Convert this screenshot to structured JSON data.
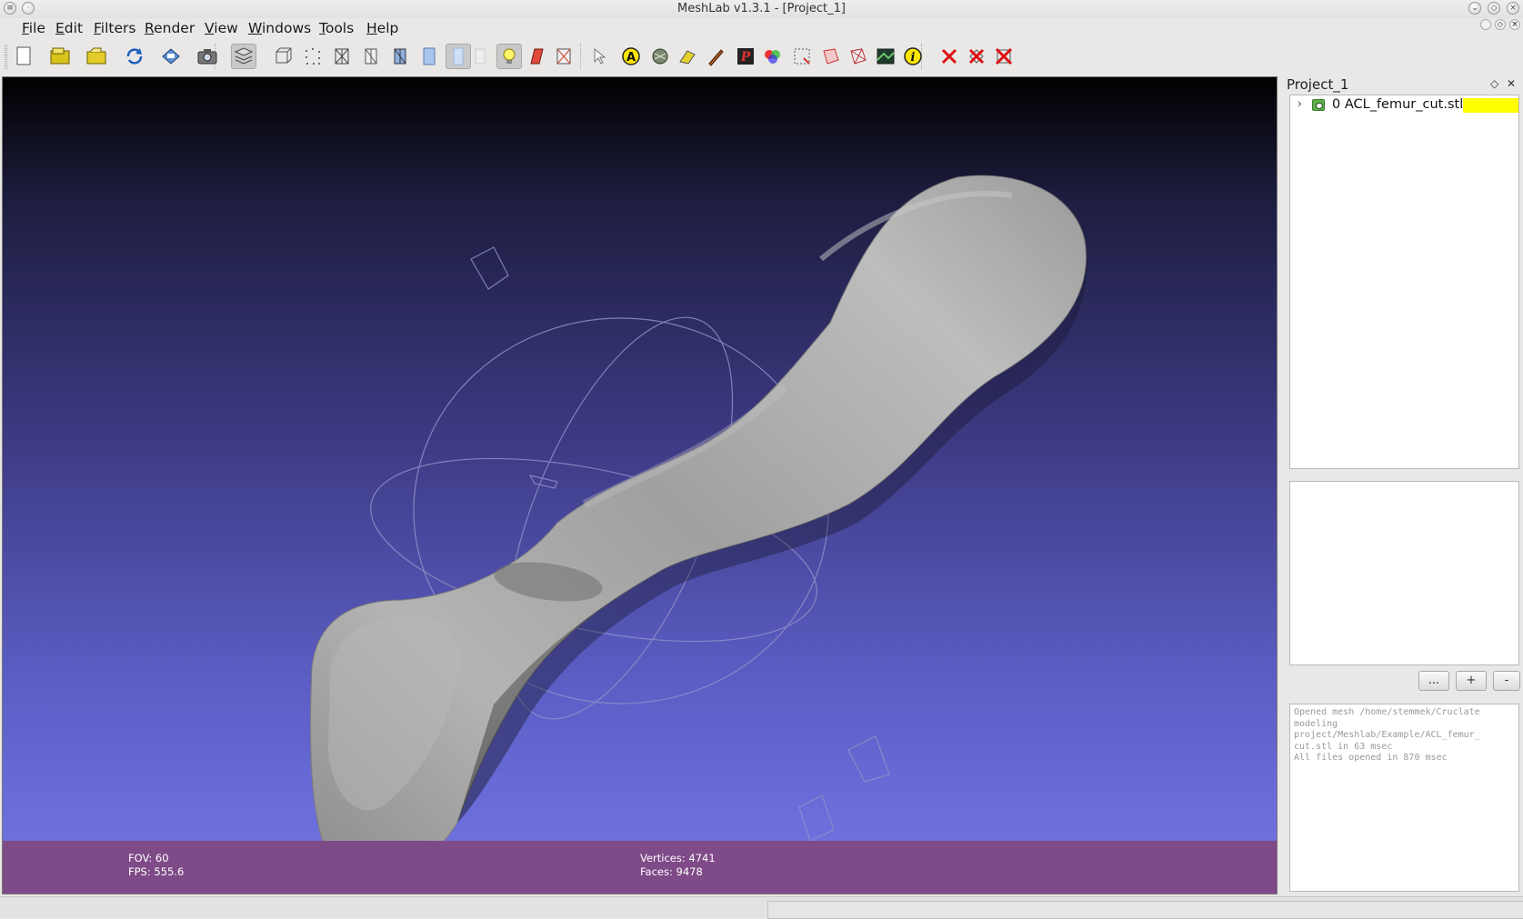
{
  "window": {
    "title": "MeshLab v1.3.1 - [Project_1]"
  },
  "menu": [
    {
      "label": "File",
      "accel": "F",
      "rest": "ile"
    },
    {
      "label": "Edit",
      "accel": "E",
      "rest": "dit"
    },
    {
      "label": "Filters",
      "accel": "F",
      "rest": "ilters"
    },
    {
      "label": "Render",
      "accel": "R",
      "rest": "ender"
    },
    {
      "label": "View",
      "accel": "V",
      "rest": "iew"
    },
    {
      "label": "Windows",
      "accel": "W",
      "rest": "indows"
    },
    {
      "label": "Tools",
      "accel": "T",
      "rest": "ools"
    },
    {
      "label": "Help",
      "accel": "H",
      "rest": "elp"
    }
  ],
  "toolbar": {
    "icons": [
      "new-project-icon",
      "open-project-icon",
      "import-mesh-icon",
      "reload-icon",
      "save-icon",
      "snapshot-icon",
      "show-layers-icon",
      "bounding-box-icon",
      "points-icon",
      "wireframe-icon",
      "hidden-lines-icon",
      "flat-lines-icon",
      "flat-icon",
      "smooth-icon",
      "texture-icon",
      "light-on-icon",
      "double-side-lighting-icon",
      "fancy-lighting-icon",
      "select-icon",
      "measure-icon",
      "align-icon",
      "manipulator-icon",
      "paint-icon",
      "pickpoints-icon",
      "color-icon",
      "select-vertices-icon",
      "select-faces-icon",
      "select-connected-icon",
      "raster-icon",
      "info-icon",
      "delete-vertices-icon",
      "delete-faces-icon",
      "delete-all-icon"
    ]
  },
  "viewport": {
    "fov_label": "FOV: 60",
    "fps_label": "FPS:   555.6",
    "vertices_label": "Vertices: 4741",
    "faces_label": "Faces: 9478",
    "background_top": "#000000",
    "background_bottom": "#7476e6",
    "info_bar_color": "#7f4a88",
    "mesh_color": "#a9a9a9"
  },
  "layers_panel": {
    "title": "Project_1",
    "layers": [
      {
        "index": "0",
        "name": "0  ACL_femur_cut.stl",
        "swatch_color": "#ffff00",
        "visible": true
      }
    ],
    "buttons": {
      "more": "...",
      "add": "+",
      "remove": "-"
    }
  },
  "log": {
    "lines": [
      "Opened mesh /home/stemmek/Cruclate",
      "modeling",
      "project/Meshlab/Example/ACL_femur_",
      "cut.stl in 63 msec",
      "All files opened in 870 msec"
    ]
  }
}
